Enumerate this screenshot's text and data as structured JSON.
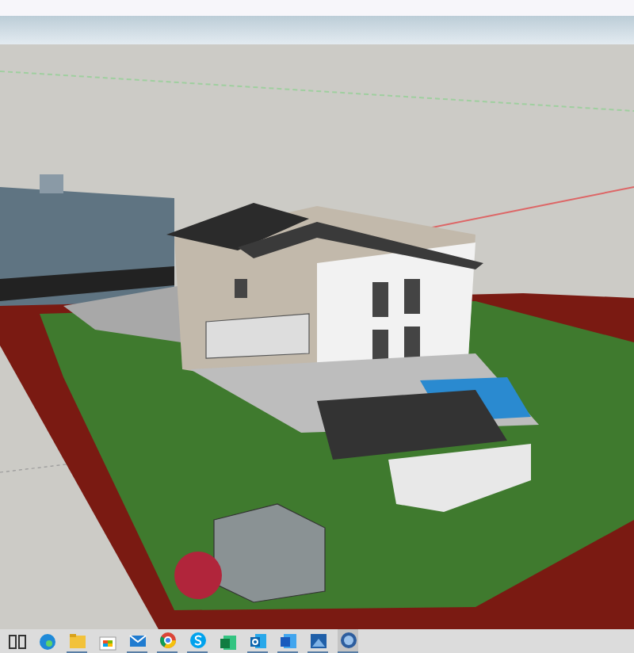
{
  "taskbar": {
    "apps": [
      {
        "kind": "taskview",
        "open": false,
        "selected": false
      },
      {
        "kind": "edge",
        "open": false,
        "selected": false
      },
      {
        "kind": "folder",
        "open": true,
        "selected": false
      },
      {
        "kind": "store",
        "open": false,
        "selected": false
      },
      {
        "kind": "mail",
        "open": true,
        "selected": false
      },
      {
        "kind": "chrome",
        "open": true,
        "selected": false
      },
      {
        "kind": "skype",
        "open": true,
        "selected": false
      },
      {
        "kind": "excel",
        "open": false,
        "selected": false
      },
      {
        "kind": "outlook",
        "open": true,
        "selected": false
      },
      {
        "kind": "word",
        "open": true,
        "selected": false
      },
      {
        "kind": "photos",
        "open": true,
        "selected": false
      },
      {
        "kind": "model",
        "open": true,
        "selected": true
      }
    ]
  }
}
